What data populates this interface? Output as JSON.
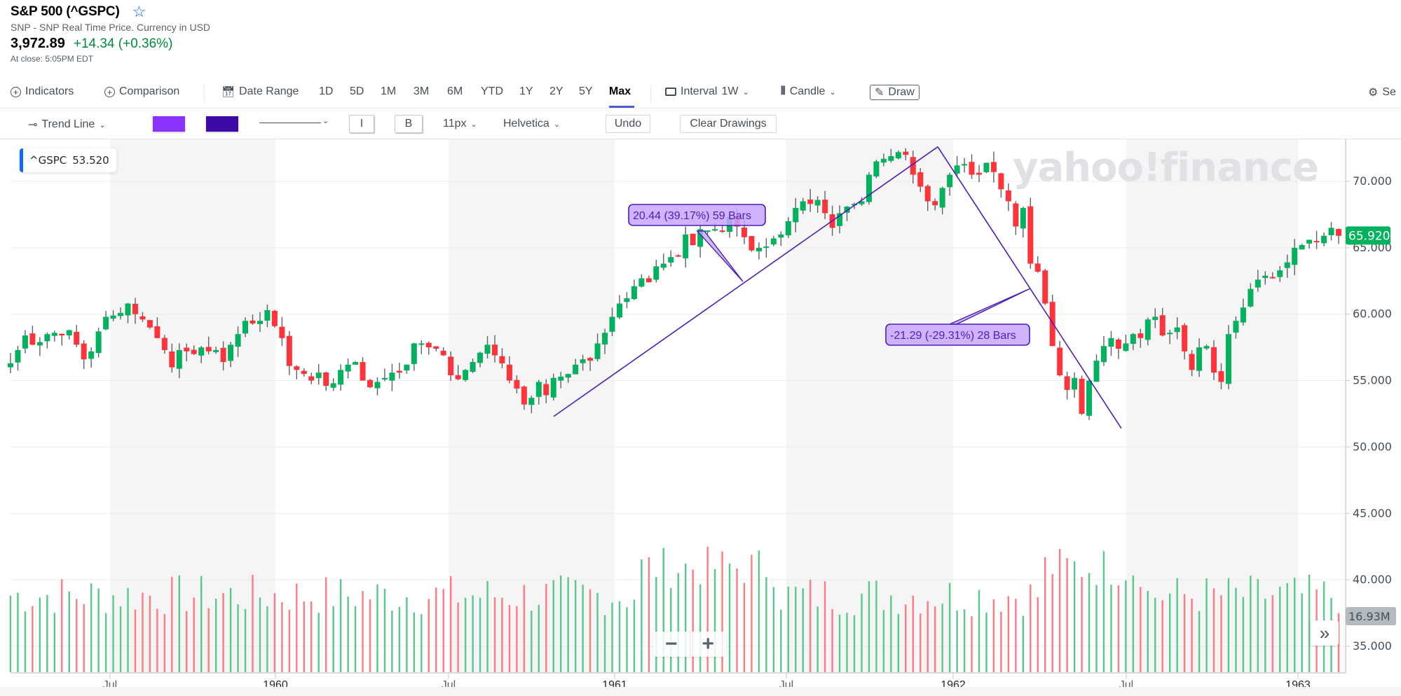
{
  "header": {
    "title": "S&P 500 (^GSPC)",
    "subtitle": "SNP - SNP Real Time Price. Currency in USD",
    "price": "3,972.89",
    "change": "+14.34 (+0.36%)",
    "close_time": "At close: 5:05PM EDT"
  },
  "toolbar": {
    "indicators": "Indicators",
    "comparison": "Comparison",
    "date_range": "Date Range",
    "ranges": [
      "1D",
      "5D",
      "1M",
      "3M",
      "6M",
      "YTD",
      "1Y",
      "2Y",
      "5Y",
      "Max"
    ],
    "active_range": "Max",
    "interval_label": "Interval",
    "interval_value": "1W",
    "chart_type": "Candle",
    "draw": "Draw",
    "settings": "Se"
  },
  "draw_toolbar": {
    "tool": "Trend Line",
    "fill_color": "#8a33ff",
    "line_color": "#3d0aa8",
    "italic": "I",
    "bold": "B",
    "font_size": "11px",
    "font_family": "Helvetica",
    "undo": "Undo",
    "clear": "Clear Drawings"
  },
  "tooltip": {
    "symbol": "^GSPC",
    "value": "53.520"
  },
  "price_label": "65.920",
  "volume_label": "16.93M",
  "zoom": {
    "minus": "−",
    "plus": "+"
  },
  "forward": "»",
  "watermark": "yahoo!finance",
  "colors": {
    "up": "#00b15d",
    "down": "#ff333a",
    "vol_up": "#5ac88d",
    "vol_down": "#ff7b7f",
    "drawing": "#4b1fb8",
    "label_bg": "#c7a6ff",
    "accent": "#0f69ff"
  },
  "chart_data": {
    "type": "candlestick",
    "title": "S&P 500 (^GSPC) weekly",
    "interval": "1W",
    "x_tick_labels": [
      "Jul",
      "1960",
      "Jul",
      "1961",
      "Jul",
      "1962",
      "Jul",
      "1963"
    ],
    "y_ticks": [
      "70.000",
      "65.000",
      "60.000",
      "55.000",
      "50.000",
      "45.000",
      "40.000",
      "35.000"
    ],
    "ylim": [
      33.3,
      73.8
    ],
    "annotations": [
      {
        "type": "trend_line",
        "from": 52.3,
        "to": 72.6,
        "label": "20.44 (39.17%) 59 Bars"
      },
      {
        "type": "trend_line",
        "from": 72.6,
        "to": 51.4,
        "label": "-21.29 (-29.31%) 28 Bars"
      }
    ],
    "closes": [
      56.3,
      57.3,
      58.4,
      57.7,
      57.9,
      58.5,
      58.6,
      58.4,
      58.8,
      57.7,
      56.6,
      57.2,
      58.7,
      59.8,
      59.9,
      60.1,
      60.8,
      60.0,
      59.6,
      59.0,
      58.2,
      57.3,
      56.0,
      57.3,
      57.2,
      57.0,
      57.5,
      57.2,
      57.3,
      56.4,
      57.7,
      58.5,
      59.5,
      59.3,
      59.5,
      60.3,
      59.1,
      58.2,
      56.1,
      55.8,
      55.5,
      55.0,
      55.6,
      54.6,
      54.8,
      55.8,
      56.2,
      56.4,
      55.0,
      54.5,
      54.9,
      55.2,
      55.6,
      55.6,
      56.2,
      57.8,
      57.8,
      57.5,
      57.4,
      56.9,
      55.4,
      55.1,
      55.8,
      56.4,
      57.1,
      57.7,
      56.9,
      56.3,
      55.0,
      54.4,
      53.2,
      53.7,
      54.9,
      53.9,
      55.2,
      55.3,
      55.5,
      56.2,
      56.6,
      56.5,
      57.8,
      58.6,
      59.8,
      60.8,
      61.2,
      62.1,
      62.7,
      62.4,
      63.6,
      63.8,
      64.3,
      64.4,
      66.0,
      65.2,
      66.4,
      66.3,
      66.4,
      66.2,
      67.3,
      66.6,
      65.8,
      64.8,
      65.0,
      65.1,
      65.7,
      66.0,
      67.0,
      68.0,
      68.5,
      68.3,
      68.6,
      67.6,
      66.5,
      67.6,
      68.1,
      68.3,
      68.5,
      70.5,
      71.5,
      71.7,
      71.9,
      72.2,
      72.0,
      70.5,
      69.6,
      68.5,
      68.2,
      69.5,
      70.5,
      71.2,
      71.3,
      70.5,
      70.5,
      71.4,
      70.7,
      69.4,
      68.5,
      66.6,
      68.0,
      63.8,
      63.2,
      60.8,
      57.6,
      55.4,
      54.3,
      55.2,
      52.5,
      55.0,
      56.5,
      57.6,
      58.2,
      57.4,
      57.8,
      58.5,
      58.2,
      59.6,
      59.8,
      58.4,
      58.6,
      59.0,
      57.2,
      55.8,
      57.5,
      57.6,
      55.6,
      54.9,
      58.5,
      59.5,
      60.5,
      61.9,
      62.6,
      62.9,
      62.8,
      63.3,
      63.9,
      65.0,
      65.2,
      65.6,
      65.5,
      65.9,
      66.5,
      65.9
    ]
  }
}
